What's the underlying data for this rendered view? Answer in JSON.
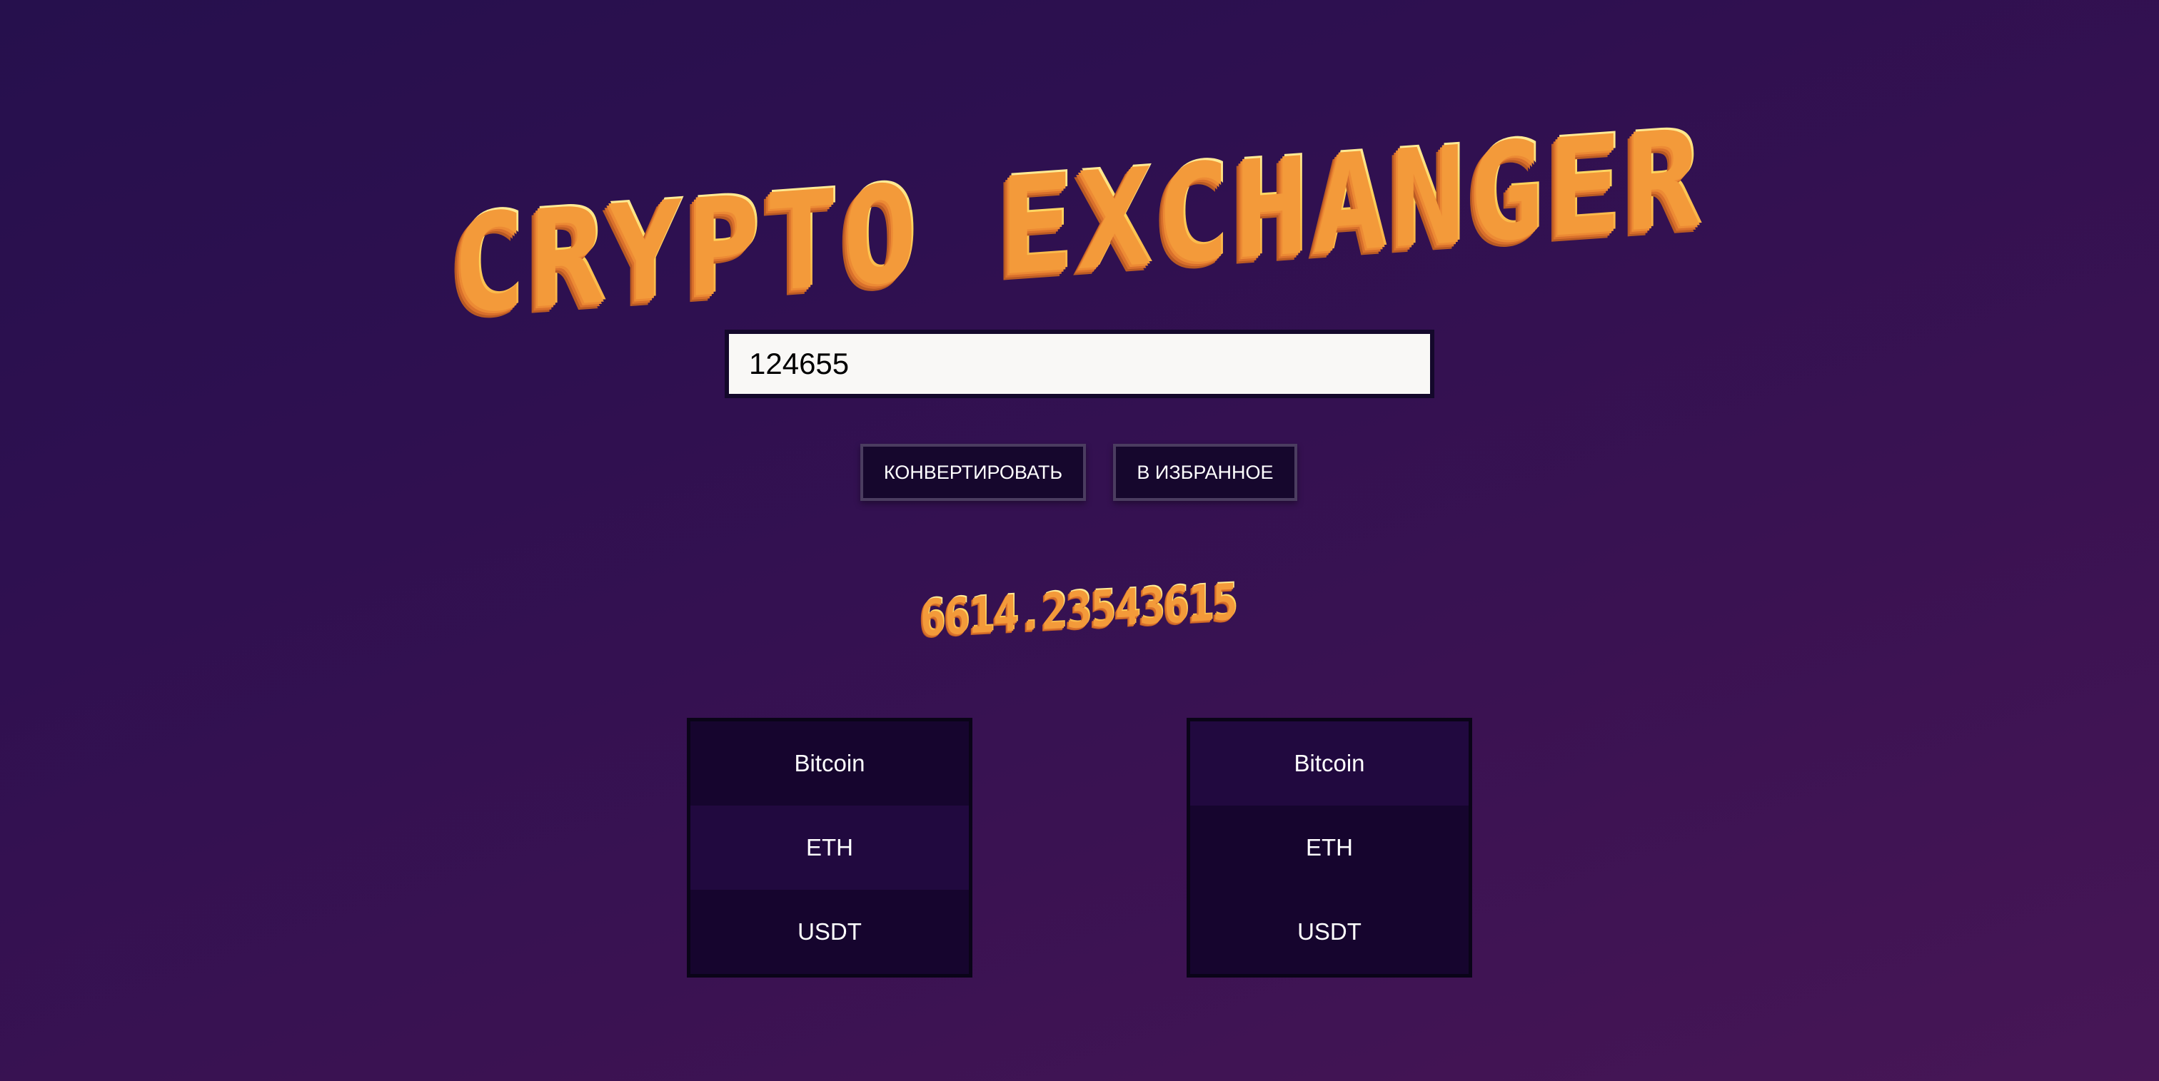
{
  "header": {
    "title": "CRYPTO EXCHANGER"
  },
  "converter": {
    "amount_value": "124655",
    "convert_label": "КОНВЕРТИРОВАТЬ",
    "favorite_label": "В ИЗБРАННОЕ",
    "result": "6614.23543615"
  },
  "from_list": {
    "items": [
      {
        "label": "Bitcoin"
      },
      {
        "label": "ETH"
      },
      {
        "label": "USDT"
      }
    ],
    "selected": "ETH"
  },
  "to_list": {
    "items": [
      {
        "label": "Bitcoin"
      },
      {
        "label": "ETH"
      },
      {
        "label": "USDT"
      }
    ],
    "selected": "Bitcoin"
  },
  "colors": {
    "background_top": "#26104d",
    "background_bottom": "#471656",
    "title_gold": "#ffd45c",
    "title_shadow": "#d9702c",
    "button_bg": "#16072d",
    "list_bg": "#16052e",
    "list_selected_bg": "#21093f"
  }
}
